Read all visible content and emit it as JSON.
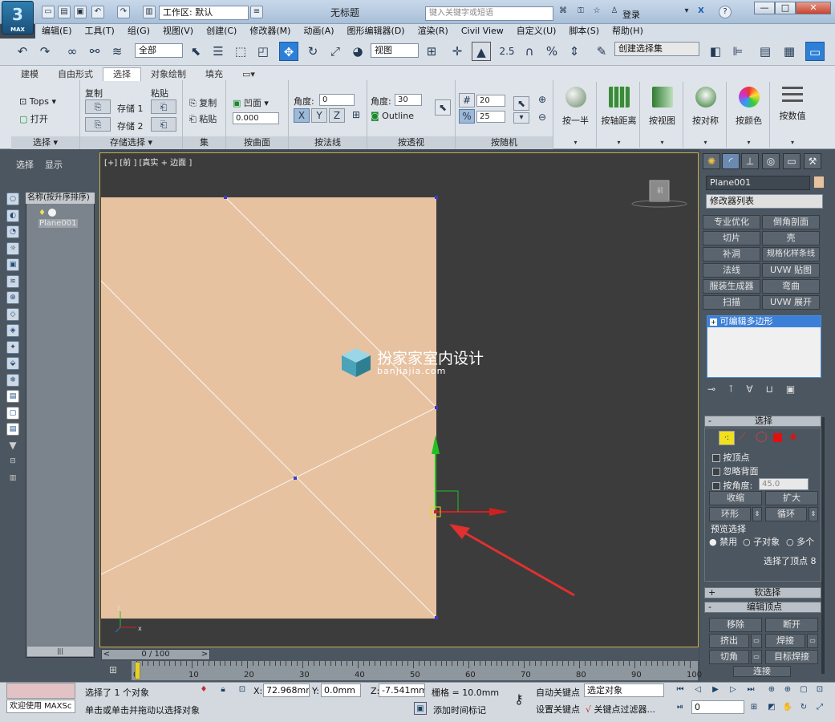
{
  "titlebar": {
    "logo_text": "3",
    "logo_sub": "MAX",
    "workspace": "工作区: 默认",
    "title": "无标题",
    "search_placeholder": "键入关键字或短语",
    "login": "登录",
    "help": "?",
    "minimize": "—",
    "maximize": "□",
    "close": "✕"
  },
  "menubar": {
    "items": [
      "编辑(E)",
      "工具(T)",
      "组(G)",
      "视图(V)",
      "创建(C)",
      "修改器(M)",
      "动画(A)",
      "图形编辑器(D)",
      "渲染(R)",
      "Civil View",
      "自定义(U)",
      "脚本(S)",
      "帮助(H)"
    ]
  },
  "maintoolbar": {
    "selection_filter": "全部",
    "ref_coord": "视图",
    "num_25": "2.5",
    "named_selection": "创建选择集"
  },
  "ribbon": {
    "tabs": [
      "建模",
      "自由形式",
      "选择",
      "对象绘制",
      "填充"
    ],
    "tops_label": "Tops",
    "open_label": "打开",
    "group_select": "选择",
    "copy_label": "复制",
    "paste_label": "粘贴",
    "store1": "存储 1",
    "store2": "存储 2",
    "group_store": "存储选择",
    "set_copy": "复制",
    "set_paste": "粘贴",
    "group_set": "集",
    "concave": "凹面",
    "concave_val": "0.000",
    "group_surface": "按曲面",
    "angle_label": "角度:",
    "angle_val": "0",
    "axes": [
      "X",
      "Y",
      "Z"
    ],
    "group_normal": "按法线",
    "angle2_label": "角度:",
    "angle2_val": "30",
    "outline": "Outline",
    "group_persp": "按透视",
    "rand_val1": "20",
    "rand_val2": "25",
    "group_random": "按随机",
    "big_buttons": [
      "按一半",
      "按轴距离",
      "按视图",
      "按对称",
      "按颜色",
      "按数值"
    ]
  },
  "left": {
    "tabs": [
      "选择",
      "显示"
    ],
    "scene_header": "名称(按升序排序)",
    "scene_item": "Plane001",
    "scroll_thumb": "|||"
  },
  "viewport": {
    "label": "[+] [前 ] [真实 + 边面 ]",
    "watermark_cn": "扮家家室内设计",
    "watermark_url": "banjiajia.com",
    "cube_label": "前"
  },
  "right": {
    "object_name": "Plane001",
    "modifier_list": "修改器列表",
    "modifier_buttons": [
      "专业优化",
      "倒角剖面",
      "切片",
      "壳",
      "补洞",
      "规格化样条线",
      "法线",
      "UVW 贴图",
      "服装生成器",
      "弯曲",
      "扫描",
      "UVW 展开"
    ],
    "stack_item": "可编辑多边形",
    "rollout_select": "选择",
    "by_vertex": "按顶点",
    "ignore_back": "忽略背面",
    "by_angle": "按角度:",
    "by_angle_val": "45.0",
    "shrink": "收缩",
    "grow": "扩大",
    "ring": "环形",
    "loop": "循环",
    "preview": "预览选择",
    "disable": "禁用",
    "subobj": "子对象",
    "multi": "多个",
    "selected_count": "选择了顶点 8",
    "soft_select": "软选择",
    "edit_vertex": "编辑顶点",
    "remove": "移除",
    "break": "断开",
    "extrude": "挤出",
    "weld": "焊接",
    "chamfer": "切角",
    "target_weld": "目标焊接",
    "connect": "连接"
  },
  "timeline": {
    "frame": "0 / 100",
    "ticks": [
      "0",
      "10",
      "20",
      "30",
      "40",
      "50",
      "60",
      "70",
      "80",
      "90",
      "100"
    ]
  },
  "status": {
    "welcome": "欢迎使用 MAXSc",
    "selected": "选择了 1 个对象",
    "prompt": "单击或单击并拖动以选择对象",
    "x_label": "X:",
    "x_val": "72.968mm",
    "y_label": "Y:",
    "y_val": "0.0mm",
    "z_label": "Z:",
    "z_val": "-7.541mm",
    "grid": "栅格 = 10.0mm",
    "add_time_tag": "添加时间标记",
    "auto_key": "自动关键点",
    "selected_obj": "选定对象",
    "set_key": "设置关键点",
    "key_filters": "关键点过滤器...",
    "frame_val": "0"
  }
}
